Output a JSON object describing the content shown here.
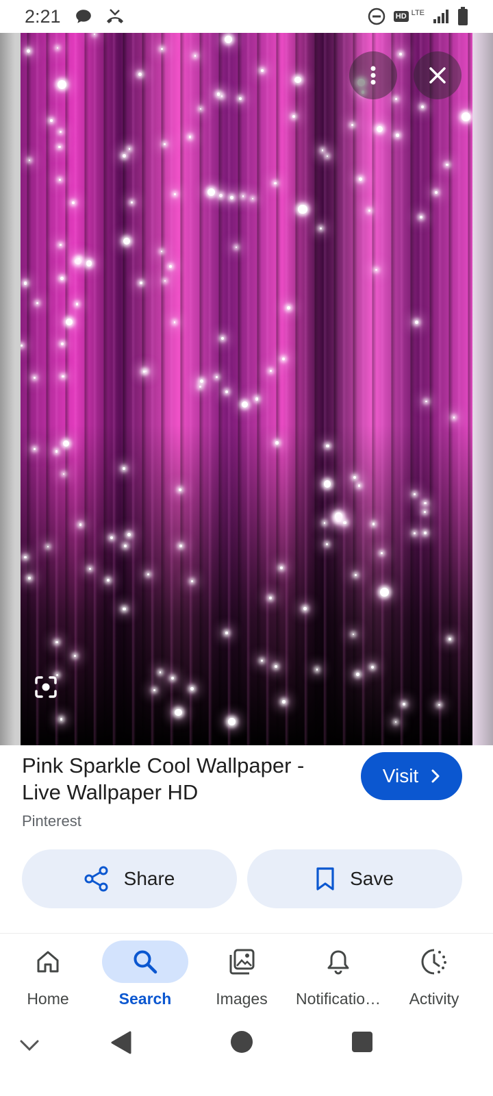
{
  "status_bar": {
    "time": "2:21",
    "icons": [
      "chat-bubble-icon",
      "missed-call-icon",
      "do-not-disturb-icon",
      "hd-icon",
      "lte-icon",
      "signal-icon",
      "battery-icon"
    ],
    "hd_label": "HD",
    "lte_label": "LTE"
  },
  "viewer": {
    "buttons": [
      "more-options-icon",
      "close-icon",
      "lens-icon"
    ],
    "image_colors": {
      "pink": "#e23bbd",
      "dark": "#000000"
    }
  },
  "result": {
    "title": "Pink Sparkle Cool Wallpaper - Live Wallpaper HD",
    "source": "Pinterest",
    "visit_label": "Visit",
    "share_label": "Share",
    "save_label": "Save"
  },
  "bottom_nav": {
    "items": [
      {
        "label": "Home",
        "icon": "home-icon",
        "active": false
      },
      {
        "label": "Search",
        "icon": "search-icon",
        "active": true
      },
      {
        "label": "Images",
        "icon": "images-icon",
        "active": false
      },
      {
        "label": "Notificatio…",
        "icon": "bell-icon",
        "active": false
      },
      {
        "label": "Activity",
        "icon": "activity-icon",
        "active": false
      }
    ]
  },
  "colors": {
    "accent": "#0b57d0",
    "pill_bg": "#e8eef9",
    "active_nav_bg": "#d3e3fd"
  }
}
